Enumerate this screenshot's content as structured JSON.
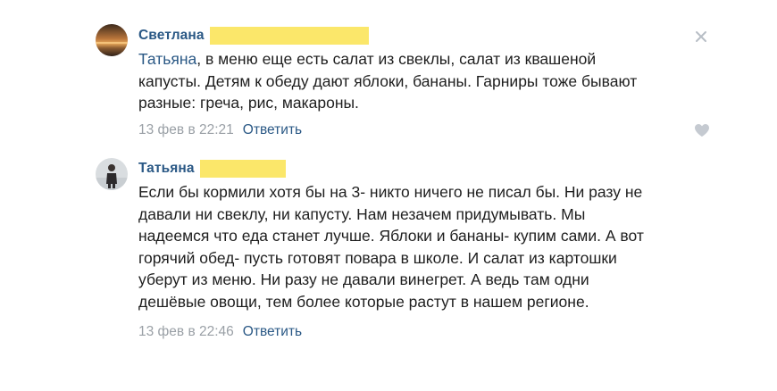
{
  "comments": [
    {
      "author": "Светлана",
      "mention": "Татьяна",
      "text_lines": [
        ", в меню еще есть салат из свеклы, салат из квашеной",
        "капусты. Детям к обеду дают яблоки, бананы. Гарниры тоже бывают",
        "разные: греча, рис, макароны."
      ],
      "date": "13 фев в 22:21",
      "reply_label": "Ответить",
      "close_icon": "close-icon",
      "like_icon": "heart-icon"
    },
    {
      "author": "Татьяна",
      "text_lines": [
        "Если бы кормили хотя бы на 3- никто ничего не писал бы. Ни разу не",
        "давали ни свеклу, ни капусту. Нам незачем придумывать. Мы",
        "надеемся что еда станет лучше. Яблоки и бананы- купим сами. А вот",
        "горячий обед- пусть готовят повара в школе. И салат из картошки",
        "уберут из меню. Ни разу не давали винегрет. А ведь там одни",
        "дешёвые овощи, тем более которые растут в нашем регионе."
      ],
      "date": "13 фев в 22:46",
      "reply_label": "Ответить"
    }
  ],
  "colors": {
    "link": "#2a5885",
    "date": "#9aa0a6",
    "redaction": "#fbe76a"
  }
}
